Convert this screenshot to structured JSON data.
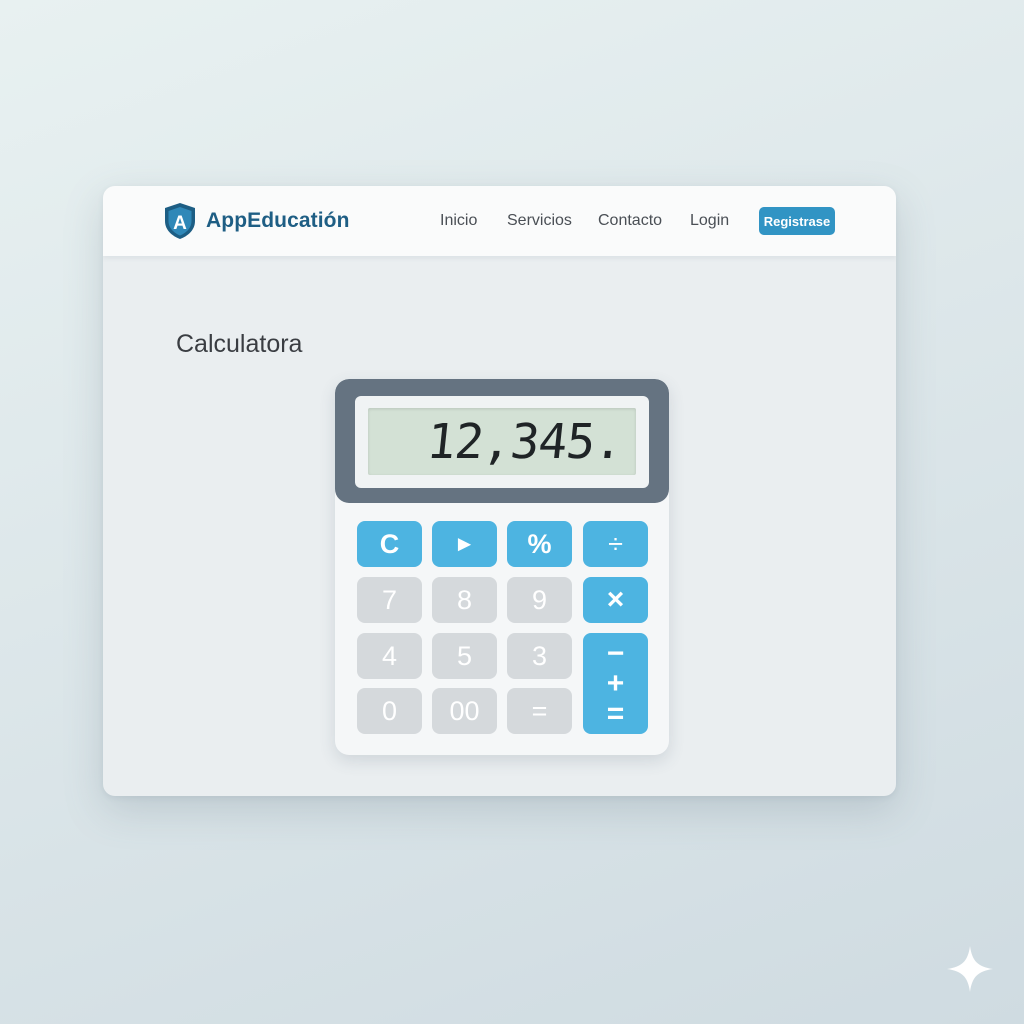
{
  "brand": {
    "logo_letter": "A",
    "name": "AppEducatión"
  },
  "nav": {
    "links": [
      "Inicio",
      "Servicios",
      "Contacto",
      "Login"
    ],
    "register_label": "Registrase"
  },
  "page": {
    "title": "Calculatora"
  },
  "calculator": {
    "display_value": "12,345.",
    "keys": {
      "clear": "C",
      "play": "►",
      "percent": "%",
      "divide": "÷",
      "seven": "7",
      "eight": "8",
      "nine": "9",
      "multiply": "×",
      "four": "4",
      "five": "5",
      "three": "3",
      "minus": "−",
      "plus": "+",
      "equals_stacked": "=",
      "zero": "0",
      "double_zero": "00",
      "equals": "="
    }
  },
  "colors": {
    "brand_text": "#1e5e84",
    "accent_button": "#3194c4",
    "key_blue": "#4db4e1",
    "key_gray": "#d5d9dc",
    "display_frame": "#657381",
    "lcd_background": "#d3e1d5"
  },
  "icons": {
    "logo": "shield-a-logo-icon",
    "corner": "sparkle-icon"
  }
}
